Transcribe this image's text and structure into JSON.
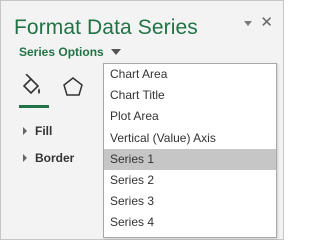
{
  "pane": {
    "title": "Format Data Series",
    "series_options_label": "Series Options",
    "sections": [
      {
        "label": "Fill"
      },
      {
        "label": "Border"
      }
    ]
  },
  "dropdown": {
    "items": [
      {
        "label": "Chart Area"
      },
      {
        "label": "Chart Title"
      },
      {
        "label": "Plot Area"
      },
      {
        "label": "Vertical (Value) Axis"
      },
      {
        "label": "Series 1",
        "selected": true
      },
      {
        "label": "Series 2"
      },
      {
        "label": "Series 3"
      },
      {
        "label": "Series 4"
      }
    ]
  },
  "icons": {
    "close": "close-icon",
    "pin": "chevron-down-icon",
    "fill_line": "paint-bucket-icon",
    "effects": "pentagon-icon"
  },
  "colors": {
    "accent": "#217346",
    "selected_bg": "#c6c6c6",
    "pane_bg": "#f3f3f3"
  }
}
